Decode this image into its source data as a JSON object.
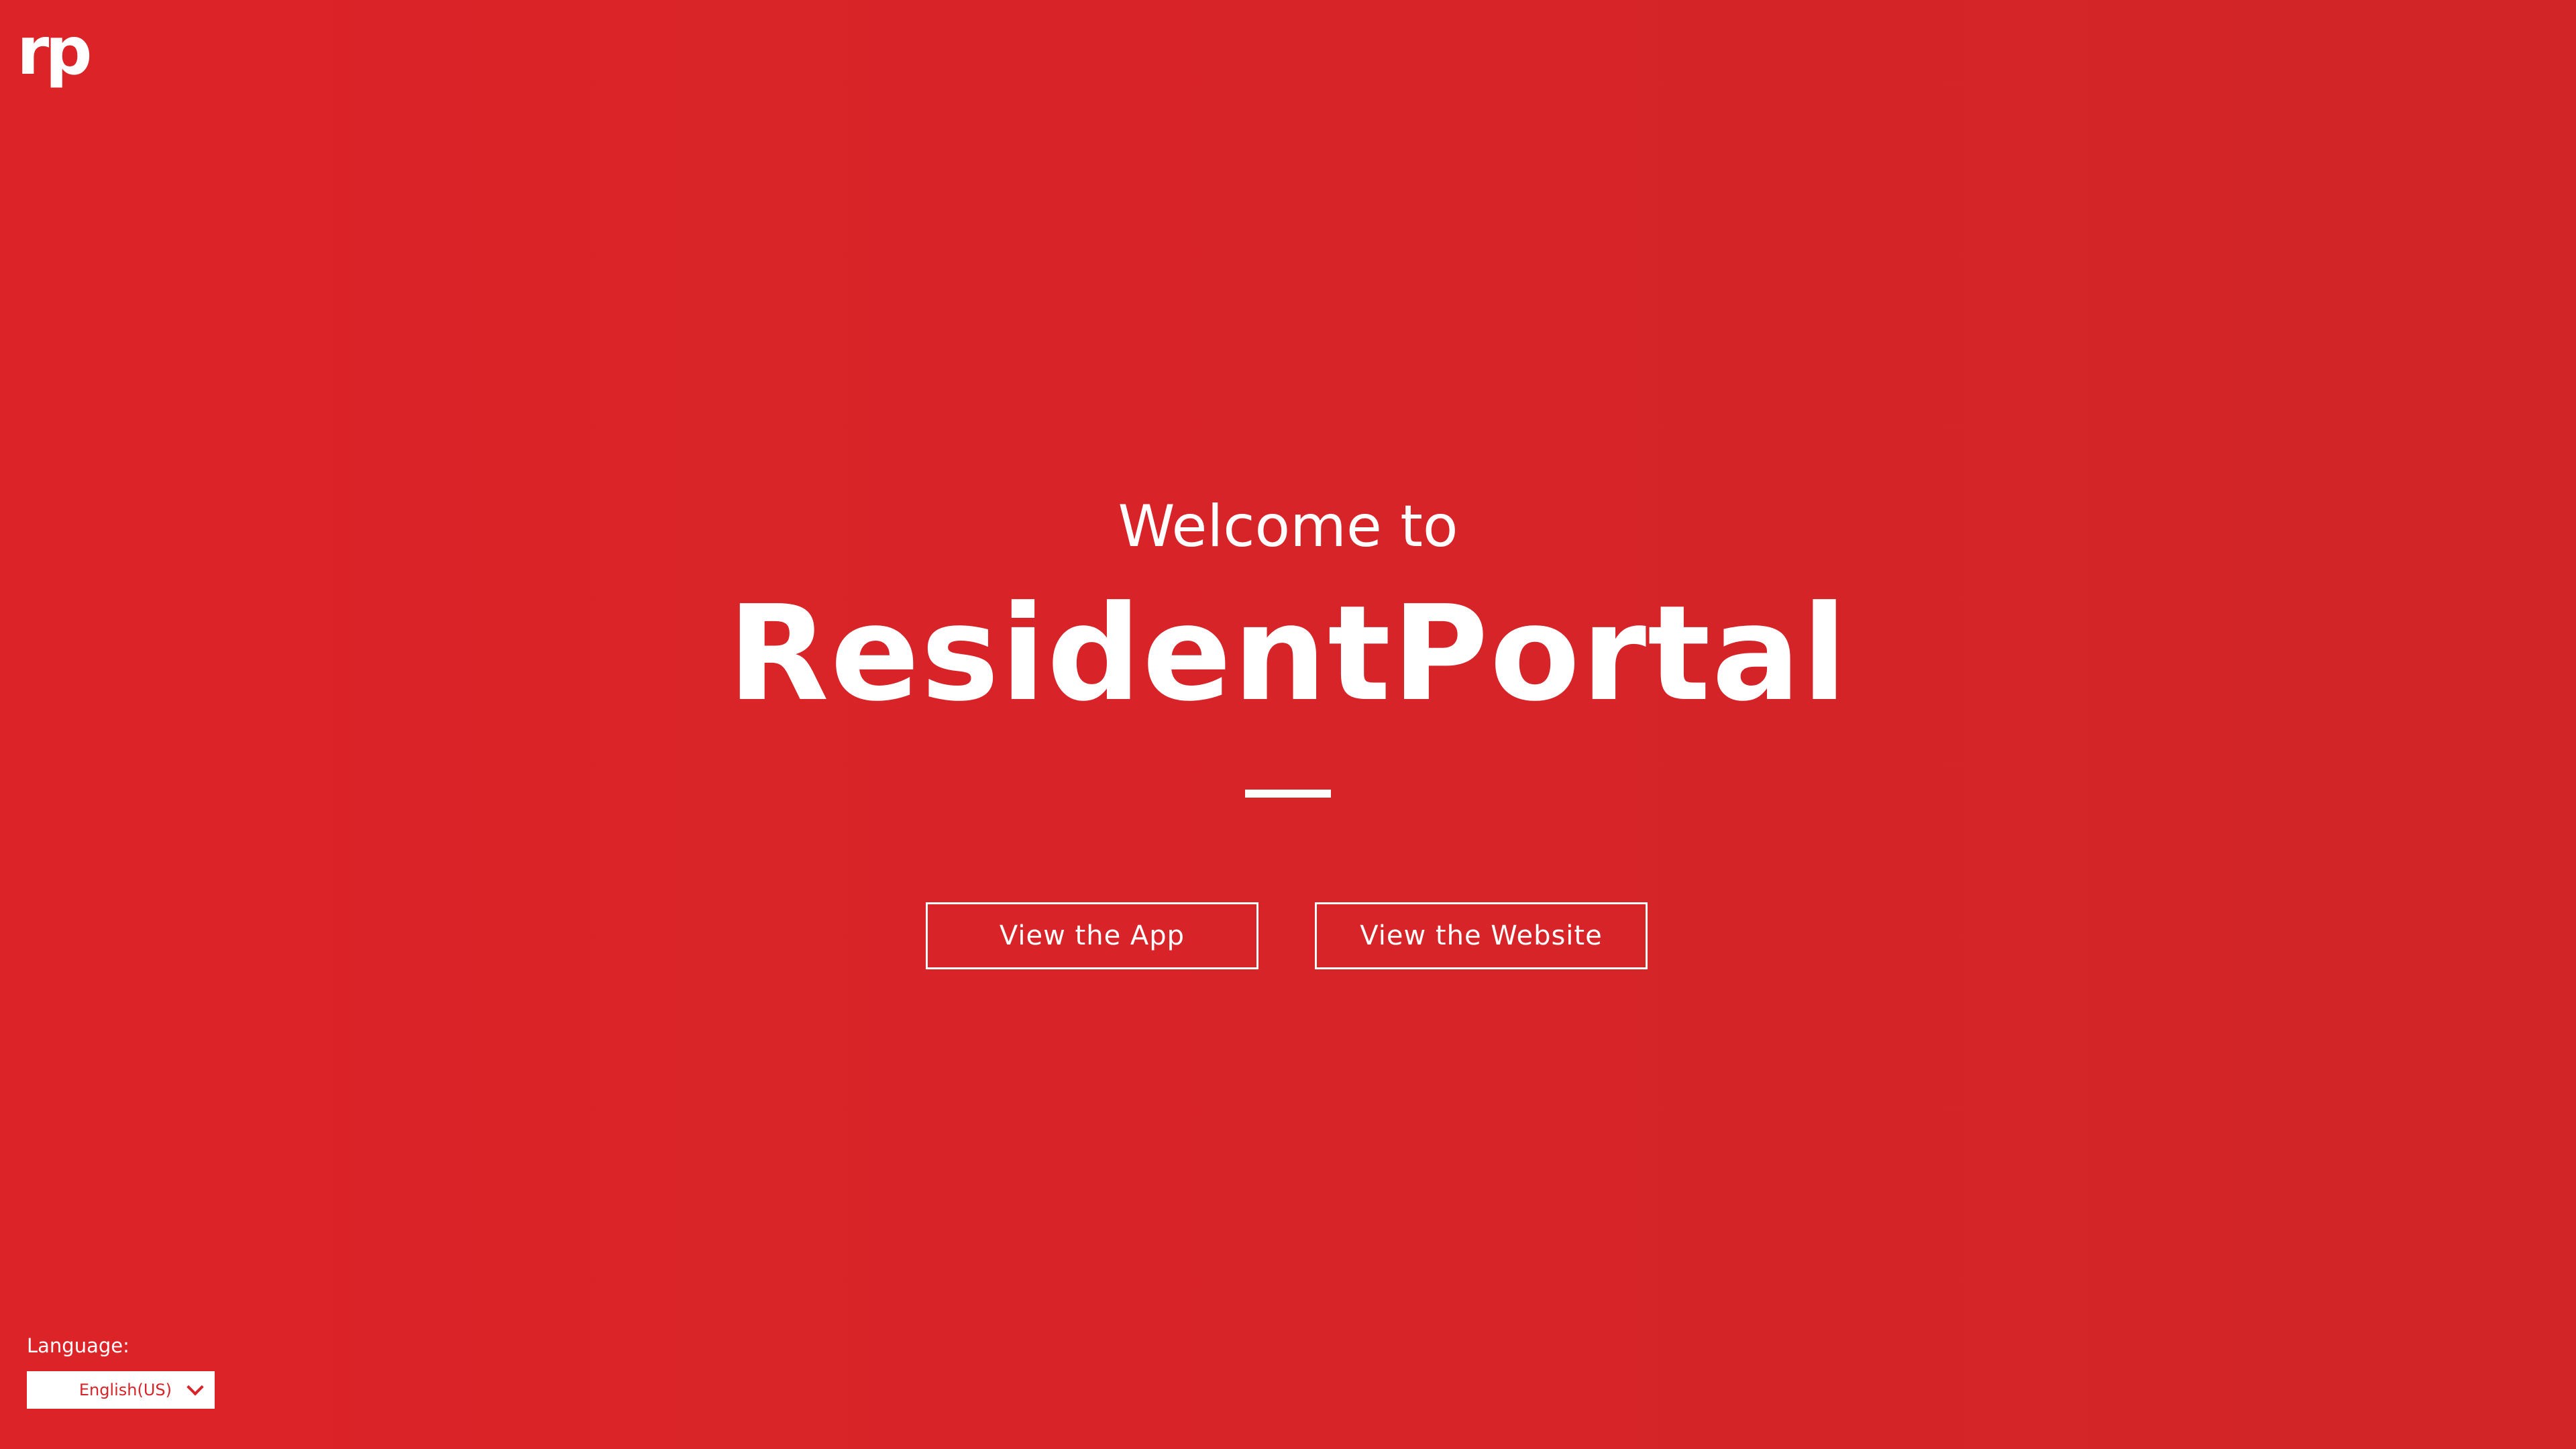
{
  "brand": {
    "logo_text": "rp",
    "background_color": "#d72428",
    "text_color": "#ffffff"
  },
  "hero": {
    "welcome": "Welcome to",
    "title": "ResidentPortal"
  },
  "actions": {
    "app_button": "View the App",
    "website_button": "View the Website"
  },
  "language": {
    "label": "Language:",
    "selected": "English(US)",
    "icon": "chevron-down-icon"
  }
}
